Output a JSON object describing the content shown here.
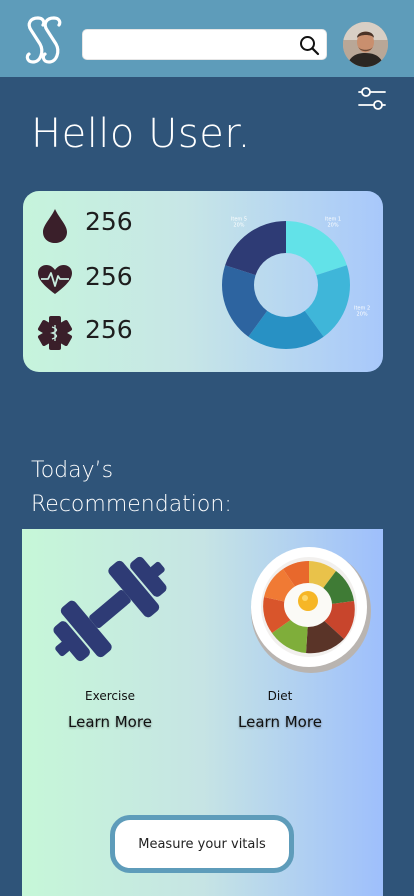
{
  "header": {
    "search": {
      "value": "",
      "placeholder": ""
    }
  },
  "greeting": "Hello User.",
  "stats": [
    {
      "icon": "blood-drop-icon",
      "value": "256"
    },
    {
      "icon": "heartbeat-icon",
      "value": "256"
    },
    {
      "icon": "medical-star-icon",
      "value": "256"
    }
  ],
  "chart_data": {
    "type": "pie",
    "donut": true,
    "categories": [
      "Item 1",
      "Item 2",
      "Item 3",
      "Item 4",
      "Item 5"
    ],
    "values": [
      20,
      20,
      20,
      20,
      20
    ],
    "value_labels": [
      "20%",
      "20%",
      "20%",
      "20%",
      "20%"
    ],
    "colors": [
      "#62e2e8",
      "#3fb6d9",
      "#2891c4",
      "#2d64a0",
      "#2e3b75"
    ],
    "title": "",
    "xlabel": "",
    "ylabel": ""
  },
  "recommendations": {
    "title_line1": "Today’s",
    "title_line2": "Recommendation:",
    "items": [
      {
        "label": "Exercise",
        "link": "Learn More"
      },
      {
        "label": "Diet",
        "link": "Learn More"
      }
    ],
    "measure_button": "Measure your vitals"
  },
  "colors": {
    "header_bg": "#5e9cba",
    "page_bg": "#2f5479",
    "icon_dark": "#3a1f2a",
    "dumbbell": "#2e3b75"
  }
}
